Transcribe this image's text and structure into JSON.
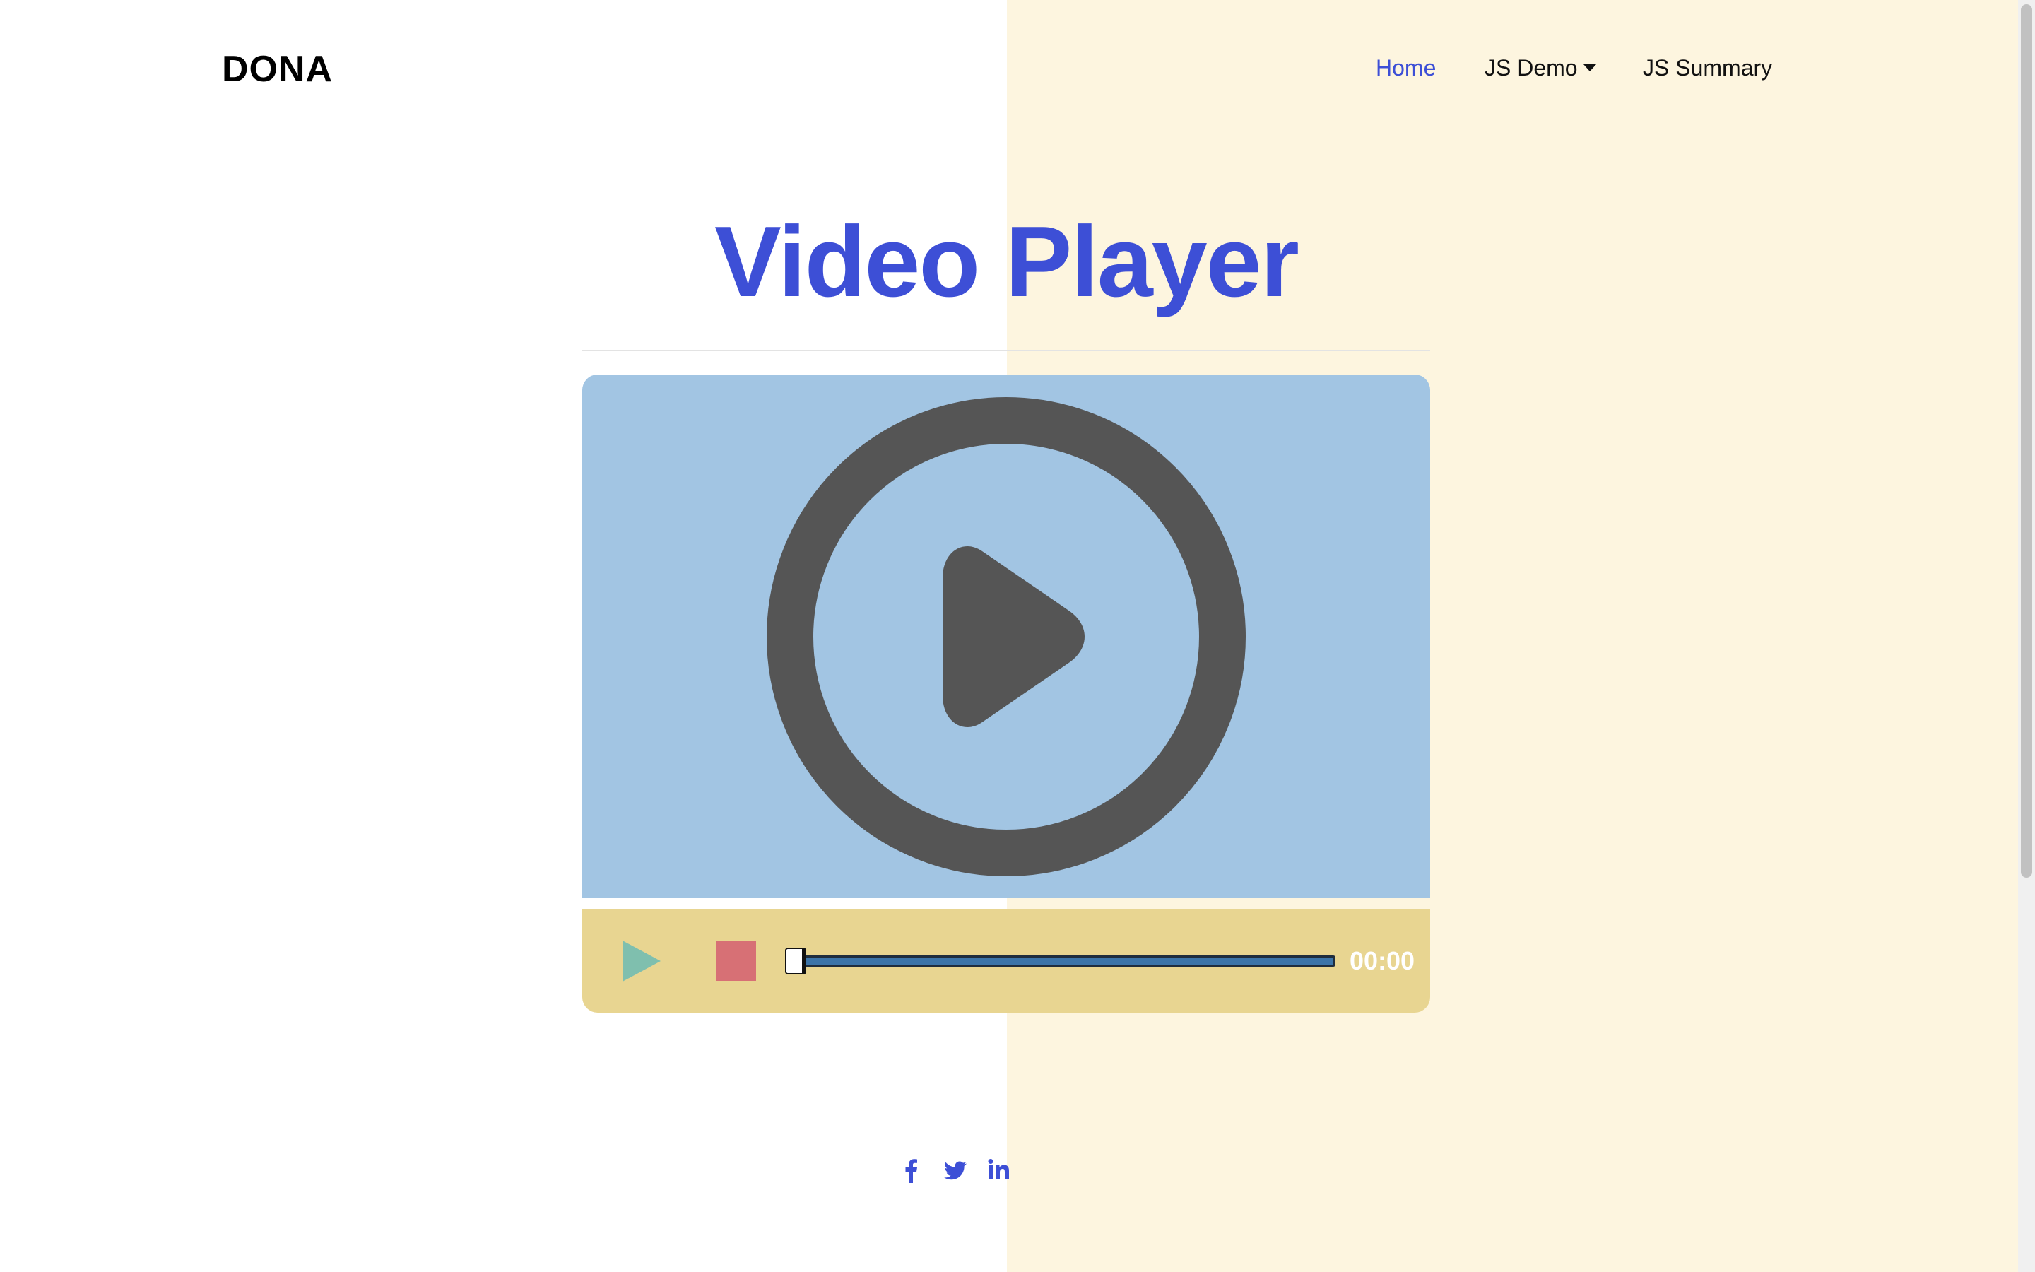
{
  "nav": {
    "brand": "DONA",
    "items": [
      {
        "label": "Home",
        "active": true
      },
      {
        "label": "JS Demo",
        "has_dropdown": true
      },
      {
        "label": "JS Summary"
      }
    ]
  },
  "page": {
    "title": "Video Player"
  },
  "player": {
    "timestamp": "00:00",
    "progress": 0.0
  },
  "social": {
    "icons": [
      "facebook-icon",
      "twitter-icon",
      "linkedin-icon"
    ]
  },
  "colors": {
    "accent": "#3d4fd6",
    "video_bg": "#a2c5e3",
    "controls_bg": "#e8d591",
    "stop_button": "#d77075",
    "play_button": "#7fbfae",
    "right_panel_bg": "#fdf5df"
  }
}
